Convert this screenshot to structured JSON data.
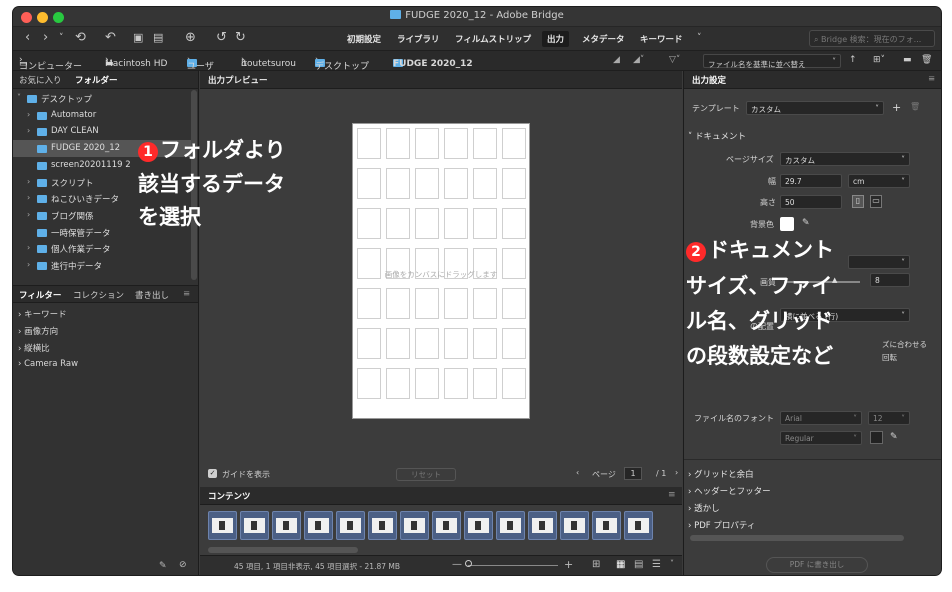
{
  "window": {
    "title": "FUDGE 2020_12 - Adobe Bridge"
  },
  "toolbar": {
    "workspaces": [
      "初期設定",
      "ライブラリ",
      "フィルムストリップ",
      "出力",
      "メタデータ",
      "キーワード"
    ],
    "search_placeholder": "Bridge 検索：現在のフォ..."
  },
  "path": {
    "items": [
      "コンピューター",
      "Macintosh HD",
      "ユーザ",
      "itoutetsurou",
      "デスクトップ",
      "FUDGE 2020_12"
    ],
    "sort_label": "ファイル名を基準に並べ替え"
  },
  "left_panel": {
    "tabs": [
      "お気に入り",
      "フォルダー"
    ],
    "tree": [
      {
        "label": "デスクトップ",
        "level": 0,
        "arrow": "˅"
      },
      {
        "label": "Automator",
        "level": 1,
        "arrow": "›"
      },
      {
        "label": "DAY CLEAN",
        "level": 1,
        "arrow": "›"
      },
      {
        "label": "FUDGE 2020_12",
        "level": 1,
        "arrow": "",
        "selected": true
      },
      {
        "label": "screen20201119 2",
        "level": 1,
        "arrow": ""
      },
      {
        "label": "スクリプト",
        "level": 1,
        "arrow": "›"
      },
      {
        "label": "ねこひいきデータ",
        "level": 1,
        "arrow": "›"
      },
      {
        "label": "ブログ関係",
        "level": 1,
        "arrow": "›"
      },
      {
        "label": "一時保管データ",
        "level": 1,
        "arrow": ""
      },
      {
        "label": "個人作業データ",
        "level": 1,
        "arrow": "›"
      },
      {
        "label": "進行中データ",
        "level": 1,
        "arrow": "›"
      }
    ],
    "filter_tabs": [
      "フィルター",
      "コレクション",
      "書き出し"
    ],
    "filters": [
      "キーワード",
      "画像方向",
      "縦横比",
      "Camera Raw"
    ]
  },
  "preview": {
    "tab": "出力プレビュー",
    "drop_message": "画像をカンバスにドラッグします",
    "show_guides": "ガイドを表示",
    "reset": "リセット",
    "page_label": "ページ",
    "page_value": "1",
    "page_total": "/ 1"
  },
  "content": {
    "tab": "コンテンツ",
    "status": "45 項目, 1 項目非表示, 45 項目選択 - 21.87 MB",
    "thumb_count": 14
  },
  "output": {
    "panel_title": "出力設定",
    "template_label": "テンプレート",
    "template_value": "カスタム",
    "doc_section": "ドキュメント",
    "page_size_label": "ページサイズ",
    "page_size_value": "カスタム",
    "width_label": "幅",
    "width_value": "29.7",
    "unit_value": "cm",
    "height_label": "高さ",
    "height_value": "50",
    "bg_label": "背景色",
    "quality_label": "画質",
    "quality_value": "8",
    "placement_label": "の配置",
    "placement_value": "横に並べる (行)",
    "fit_label": "ズに合わせる",
    "rotate_label": "回転",
    "filename_font_label": "ファイル名のフォント",
    "font_value": "Arial",
    "font_size_value": "12",
    "font_style_value": "Regular",
    "sections": [
      "グリッドと余白",
      "ヘッダーとフッター",
      "透かし",
      "PDF プロパティ"
    ],
    "pdf_button": "PDF に書き出し"
  },
  "annotations": {
    "step1_num": "1",
    "step1_lines": [
      "フォルダより",
      "該当するデータ",
      "を選択"
    ],
    "step2_num": "2",
    "step2_lines": [
      "ドキュメント",
      "サイズ、ファイ",
      "ル名、グリッド",
      "の段数設定など"
    ]
  },
  "colors": {
    "accent": "#5fb0e8",
    "annotation_red": "#ff2a2a"
  }
}
